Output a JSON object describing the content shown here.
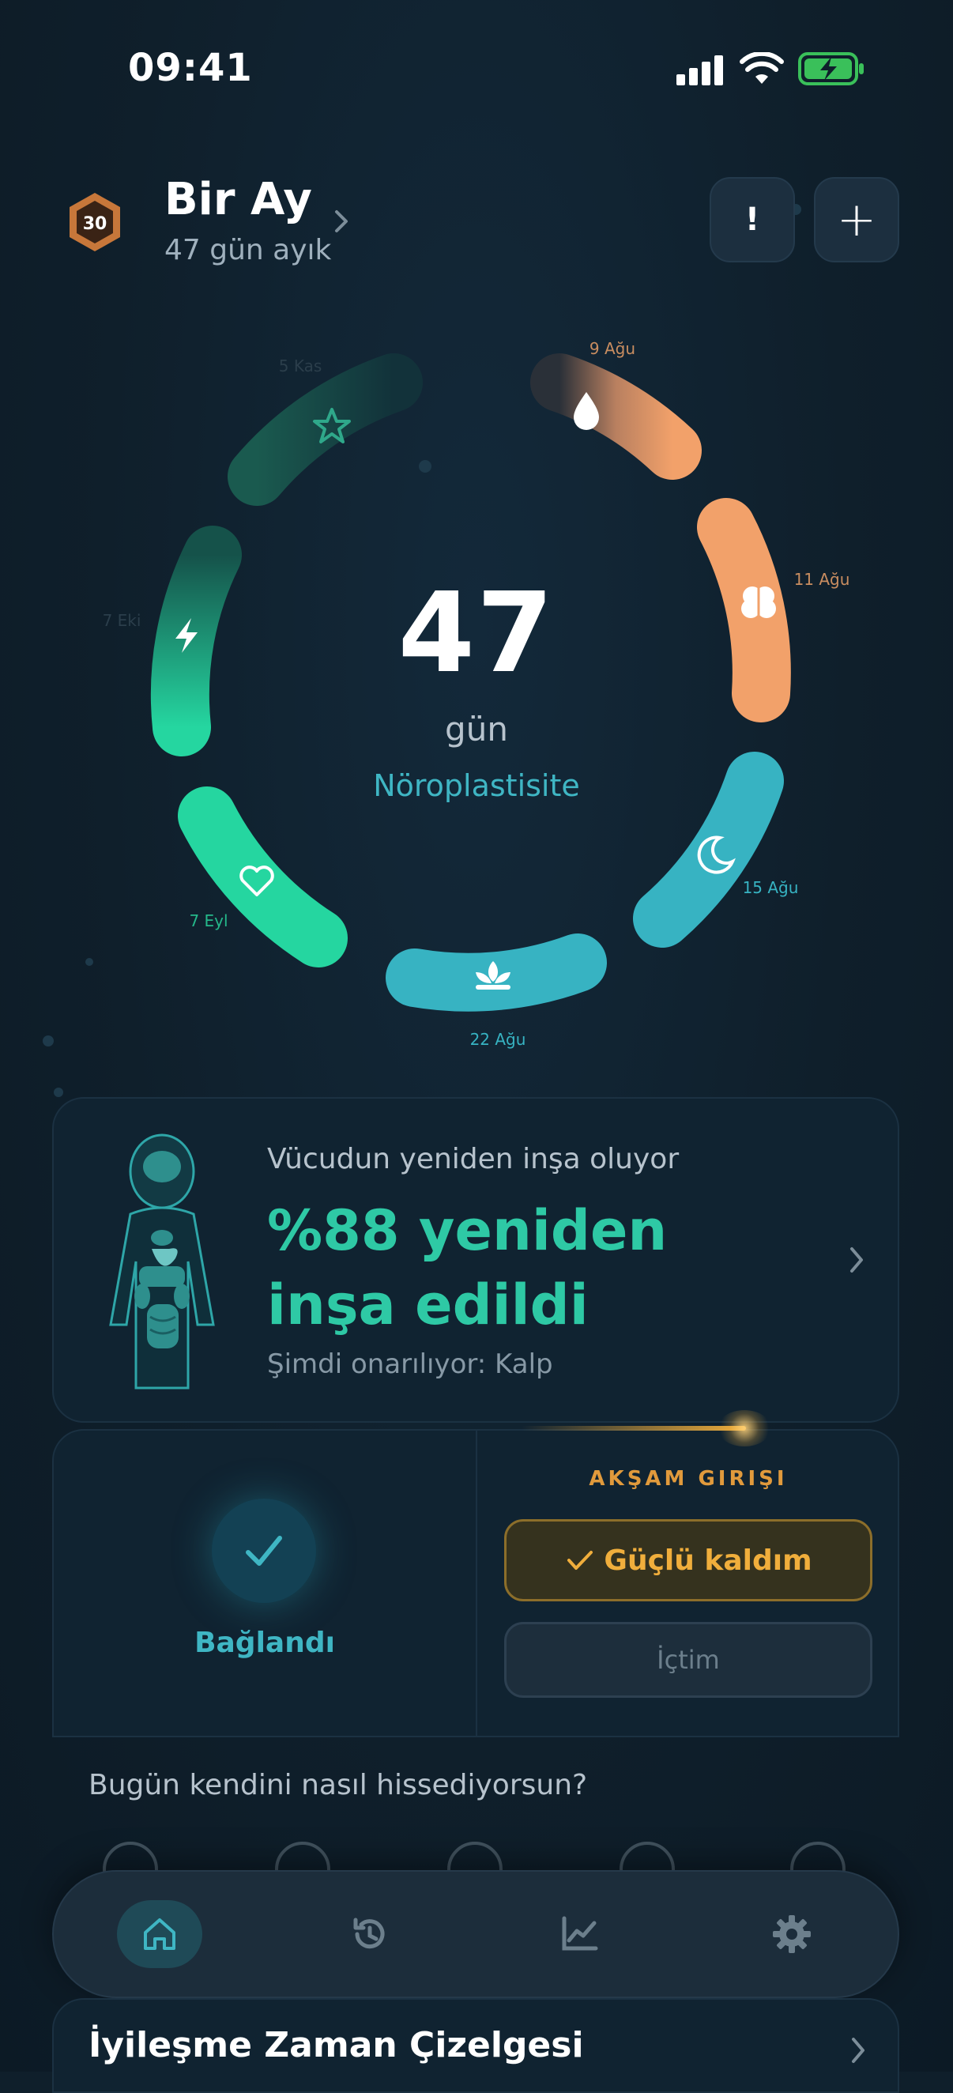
{
  "status_bar": {
    "time": "09:41"
  },
  "header": {
    "badge_level": "30",
    "title": "Bir Ay",
    "subtitle": "47 gün ayık",
    "alert_label": "!",
    "add_label": "+"
  },
  "ring": {
    "day_count": "47",
    "unit": "gün",
    "stage": "Nöroplastisite",
    "segments": [
      {
        "date": "5 Kas",
        "icon": "star-icon",
        "color": "#1a5a4f"
      },
      {
        "date": "9 Ağu",
        "icon": "drop-icon",
        "color": "#f2a16a"
      },
      {
        "date": "11 Ağu",
        "icon": "brain-icon",
        "color": "#f2a16a"
      },
      {
        "date": "15 Ağu",
        "icon": "moon-icon",
        "color": "#37b3c2"
      },
      {
        "date": "22 Ağu",
        "icon": "lotus-icon",
        "color": "#37b3c2"
      },
      {
        "date": "7 Eyl",
        "icon": "heart-icon",
        "color": "#25d6a0"
      },
      {
        "date": "7 Eki",
        "icon": "bolt-icon",
        "color": "#25d6a0"
      }
    ]
  },
  "rebuild": {
    "kicker": "Vücudun yeniden inşa oluyor",
    "title": "%88 yeniden inşa edildi",
    "subtitle": "Şimdi onarılıyor: Kalp"
  },
  "checkin": {
    "connected_label": "Bağlandı",
    "evening_label": "AKŞAM GIRIŞI",
    "strong_label": "Güçlü kaldım",
    "drank_label": "İçtim"
  },
  "mood": {
    "question": "Bugün kendini nasıl hissediyorsun?"
  },
  "nav": {
    "items": [
      "home-icon",
      "history-icon",
      "chart-icon",
      "settings-icon"
    ]
  },
  "timeline": {
    "title": "İyileşme Zaman Çizelgesi"
  },
  "colors": {
    "accent_teal": "#3fb6c4",
    "accent_green": "#2ec9a5",
    "accent_orange": "#f0ae3c"
  }
}
